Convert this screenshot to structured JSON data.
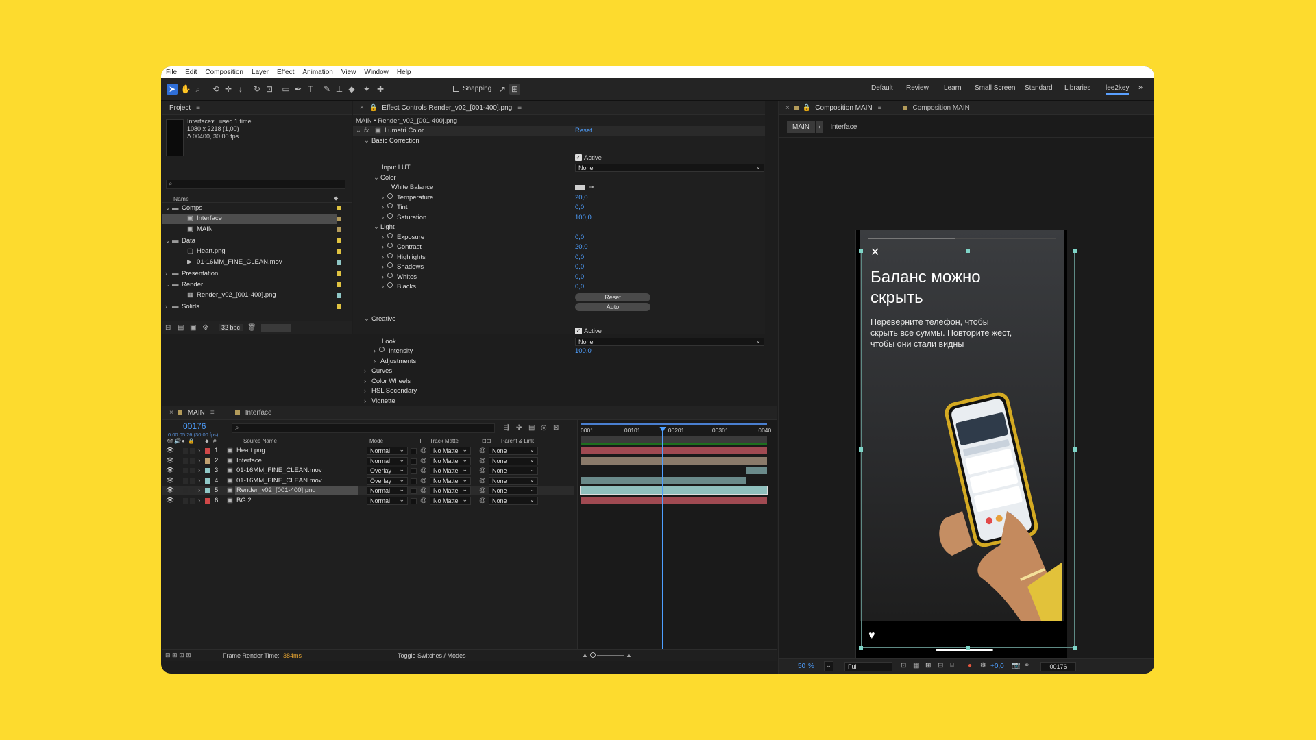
{
  "menu": [
    "File",
    "Edit",
    "Composition",
    "Layer",
    "Effect",
    "Animation",
    "View",
    "Window",
    "Help"
  ],
  "toolbar": {
    "snapping_label": "Snapping",
    "workspaces": [
      "Default",
      "Review",
      "Learn",
      "Small Screen",
      "Standard",
      "Libraries",
      "lee2key"
    ],
    "active_workspace": "lee2key"
  },
  "project": {
    "tab": "Project",
    "selected_name": "Interface▾ , used 1 time",
    "selected_size": "1080 x 2218 (1,00)",
    "selected_duration": "Δ 00400, 30,00 fps",
    "col_name": "Name",
    "items": [
      {
        "label": "Comps",
        "type": "folder",
        "indent": 0,
        "open": true,
        "color": "#e0c341"
      },
      {
        "label": "Interface",
        "type": "comp",
        "indent": 1,
        "selected": true,
        "color": "#b39b5a"
      },
      {
        "label": "MAIN",
        "type": "comp",
        "indent": 1,
        "color": "#b39b5a"
      },
      {
        "label": "Data",
        "type": "folder",
        "indent": 0,
        "open": true,
        "color": "#e0c341"
      },
      {
        "label": "Heart.png",
        "type": "image",
        "indent": 1,
        "color": "#e0c341"
      },
      {
        "label": "01-16MM_FINE_CLEAN.mov",
        "type": "video",
        "indent": 1,
        "color": "#8fc7c6"
      },
      {
        "label": "Presentation",
        "type": "folder",
        "indent": 0,
        "open": false,
        "color": "#e0c341"
      },
      {
        "label": "Render",
        "type": "folder",
        "indent": 0,
        "open": true,
        "color": "#e0c341"
      },
      {
        "label": "Render_v02_[001-400].png",
        "type": "sequence",
        "indent": 1,
        "color": "#8fc7c6"
      },
      {
        "label": "Solids",
        "type": "folder",
        "indent": 0,
        "open": false,
        "color": "#e0c341"
      }
    ],
    "bpc": "32 bpc"
  },
  "effects": {
    "tab": "Effect Controls Render_v02_[001-400].png",
    "subtitle": "MAIN • Render_v02_[001-400].png",
    "effect_name": "Lumetri Color",
    "reset": "Reset",
    "basic_correction": "Basic Correction",
    "active": "Active",
    "input_lut_label": "Input LUT",
    "input_lut_value": "None",
    "color_group": "Color",
    "white_balance": "White Balance",
    "color_params": [
      {
        "label": "Temperature",
        "value": "20,0"
      },
      {
        "label": "Tint",
        "value": "0,0"
      },
      {
        "label": "Saturation",
        "value": "100,0"
      }
    ],
    "light_group": "Light",
    "light_params": [
      {
        "label": "Exposure",
        "value": "0,0"
      },
      {
        "label": "Contrast",
        "value": "20,0"
      },
      {
        "label": "Highlights",
        "value": "0,0"
      },
      {
        "label": "Shadows",
        "value": "0,0"
      },
      {
        "label": "Whites",
        "value": "0,0"
      },
      {
        "label": "Blacks",
        "value": "0,0"
      }
    ],
    "reset_btn": "Reset",
    "auto_btn": "Auto",
    "creative": "Creative",
    "creative_active": "Active",
    "look_label": "Look",
    "look_value": "None",
    "intensity_label": "Intensity",
    "intensity_value": "100,0",
    "adjustments": "Adjustments",
    "sections": [
      "Curves",
      "Color Wheels",
      "HSL Secondary",
      "Vignette"
    ]
  },
  "composition": {
    "tab_active": "Composition MAIN",
    "tab_other": "Composition MAIN",
    "breadcrumb_main": "MAIN",
    "breadcrumb_child": "Interface",
    "title": "Баланс можно скрыть",
    "body": "Переверните телефон, чтобы скрыть все суммы. Повторите жест, чтобы они стали видны",
    "zoom": "50",
    "zoom_unit": "%",
    "resolution": "Full",
    "exposure": "+0,0",
    "timecode": "00176"
  },
  "timeline": {
    "tab_main": "MAIN",
    "tab_interface": "Interface",
    "timecode": "00176",
    "timecode_sub": "0:00:05:26 (30.00 fps)",
    "ruler": [
      "0001",
      "00101",
      "00201",
      "00301",
      "0040"
    ],
    "col_source": "Source Name",
    "col_mode": "Mode",
    "col_t": "T",
    "col_track": "Track Matte",
    "col_parent": "Parent & Link",
    "layers": [
      {
        "num": "1",
        "name": "Heart.png",
        "mode": "Normal",
        "matte": "No Matte",
        "parent": "None",
        "label_color": "#d04848",
        "bar_color": "#a04a52",
        "selected": false
      },
      {
        "num": "2",
        "name": "Interface",
        "mode": "Normal",
        "matte": "No Matte",
        "parent": "None",
        "label_color": "#c0a070",
        "bar_color": "#8a7a6a",
        "selected": false
      },
      {
        "num": "3",
        "name": "01-16MM_FINE_CLEAN.mov",
        "mode": "Overlay",
        "matte": "No Matte",
        "parent": "None",
        "label_color": "#8fc7c6",
        "bar_color": "#6a8a8a",
        "selected": false
      },
      {
        "num": "4",
        "name": "01-16MM_FINE_CLEAN.mov",
        "mode": "Overlay",
        "matte": "No Matte",
        "parent": "None",
        "label_color": "#8fc7c6",
        "bar_color": "#6a8a8a",
        "selected": false
      },
      {
        "num": "5",
        "name": "Render_v02_[001-400].png",
        "mode": "Normal",
        "matte": "No Matte",
        "parent": "None",
        "label_color": "#8fc7c6",
        "bar_color": "#8fbfbd",
        "selected": true
      },
      {
        "num": "6",
        "name": "BG 2",
        "mode": "Normal",
        "matte": "No Matte",
        "parent": "None",
        "label_color": "#d04848",
        "bar_color": "#a04a52",
        "selected": false
      }
    ],
    "playhead_fraction": 0.4375
  },
  "status": {
    "render_label": "Frame Render Time:",
    "render_value": "384ms",
    "toggle": "Toggle Switches / Modes"
  }
}
